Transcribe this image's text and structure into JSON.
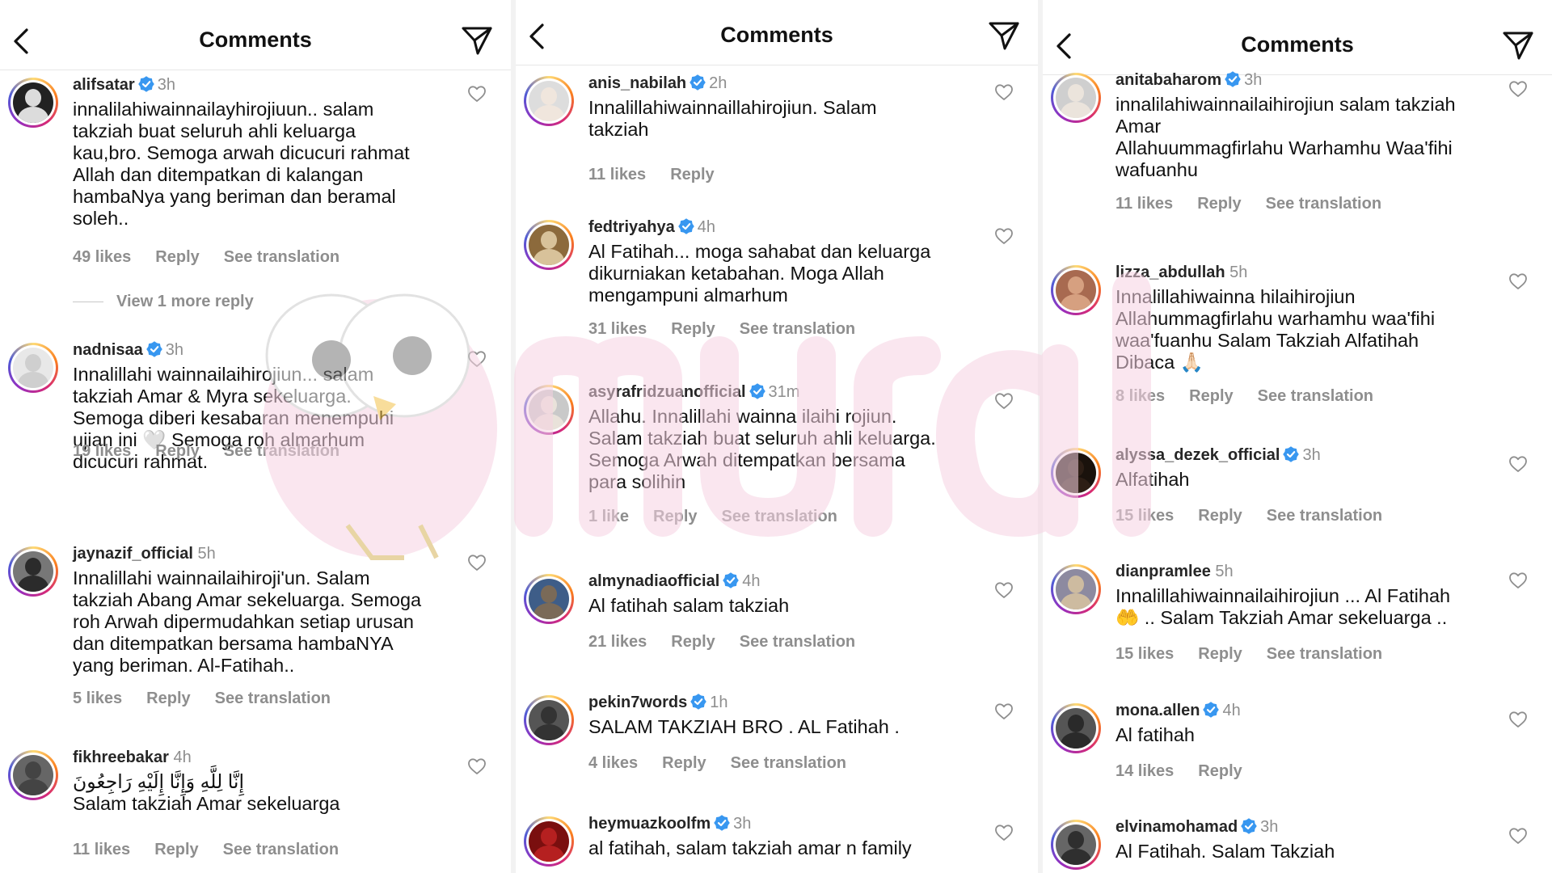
{
  "header_title": "Comments",
  "icons": {
    "back": "chevron-left-icon",
    "share": "send-icon",
    "verified": "verified-badge-icon",
    "like": "heart-outline-icon"
  },
  "colors": {
    "verified": "#3897f0",
    "secondary_text": "#8e8e8e",
    "watermark": "#f6d2e2"
  },
  "watermark": {
    "logo": "mural"
  },
  "panels": [
    {
      "comments": [
        {
          "username": "alifsatar",
          "verified": true,
          "time": "3h",
          "text": "innalilahiwainnailayhirojiuun.. salam\ntakziah buat seluruh ahli keluarga\nkau,bro. Semoga arwah dicucuri rahmat\nAllah dan ditempatkan di kalangan\nhambaNya yang beriman dan beramal\nsoleh..",
          "likes": "49 likes",
          "reply": "Reply",
          "translation": "See translation",
          "more_replies": "View 1 more reply"
        },
        {
          "username": "nadnisaa",
          "verified": true,
          "time": "3h",
          "text": "Innalillahi wainnailaihirojiun... salam\ntakziah Amar & Myra sekeluarga.\nSemoga diberi kesabaran menempuhi\nujian ini 🤍 Semoga roh almarhum\ndicucuri rahmat.",
          "likes": "19 likes",
          "reply": "Reply",
          "translation": "See translation"
        },
        {
          "username": "jaynazif_official",
          "verified": false,
          "time": "5h",
          "text": "Innalillahi wainnailaihiroji'un. Salam\ntakziah Abang Amar sekeluarga. Semoga\nroh Arwah dipermudahkan setiap urusan\ndan ditempatkan bersama hambaNYA\nyang beriman. Al-Fatihah..",
          "likes": "5 likes",
          "reply": "Reply",
          "translation": "See translation"
        },
        {
          "username": "fikhreebakar",
          "verified": false,
          "time": "4h",
          "text": "إِنَّا لِلَّهِ وَإِنَّا إِلَيْهِ رَاجِعُونَ\nSalam takziah Amar sekeluarga",
          "likes": "11 likes",
          "reply": "Reply",
          "translation": "See translation"
        }
      ]
    },
    {
      "comments": [
        {
          "username": "anis_nabilah",
          "verified": true,
          "time": "2h",
          "text": "Innalillahiwainnaillahirojiun. Salam\ntakziah",
          "likes": "11 likes",
          "reply": "Reply"
        },
        {
          "username": "fedtriyahya",
          "verified": true,
          "time": "4h",
          "text": "Al Fatihah... moga sahabat dan keluarga\ndikurniakan ketabahan. Moga Allah\nmengampuni almarhum",
          "likes": "31 likes",
          "reply": "Reply",
          "translation": "See translation"
        },
        {
          "username": "asyrafridzuanofficial",
          "verified": true,
          "time": "31m",
          "text": "Allahu. Innalillahi wainna ilaihi rojiun.\nSalam takziah buat seluruh ahli keluarga.\nSemoga Arwah ditempatkan bersama\npara solihin",
          "likes": "1 like",
          "reply": "Reply",
          "translation": "See translation"
        },
        {
          "username": "almynadiaofficial",
          "verified": true,
          "time": "4h",
          "text": "Al fatihah salam takziah",
          "likes": "21 likes",
          "reply": "Reply",
          "translation": "See translation"
        },
        {
          "username": "pekin7words",
          "verified": true,
          "time": "1h",
          "text": "SALAM TAKZIAH BRO . AL Fatihah .",
          "likes": "4 likes",
          "reply": "Reply",
          "translation": "See translation"
        },
        {
          "username": "heymuazkoolfm",
          "verified": true,
          "time": "3h",
          "text": "al fatihah, salam takziah amar n family"
        }
      ]
    },
    {
      "comments": [
        {
          "username": "anitabaharom",
          "verified": true,
          "time": "3h",
          "text": "innalilahiwainnailaihirojiun salam takziah\nAmar\nAllahuummagfirlahu Warhamhu Waa'fihi\nwafuanhu",
          "likes": "11 likes",
          "reply": "Reply",
          "translation": "See translation"
        },
        {
          "username": "lizza_abdullah",
          "verified": false,
          "time": "5h",
          "text": "Innalillahiwainna hilaihirojiun\nAllahummagfirlahu warhamhu waa'fihi\nwaa'fuanhu Salam Takziah Alfatihah\nDibaca 🙏🏻",
          "likes": "8 likes",
          "reply": "Reply",
          "translation": "See translation"
        },
        {
          "username": "alyssa_dezek_official",
          "verified": true,
          "time": "3h",
          "text": "Alfatihah",
          "likes": "15 likes",
          "reply": "Reply",
          "translation": "See translation"
        },
        {
          "username": "dianpramlee",
          "verified": false,
          "time": "5h",
          "text": "Innalillahiwainnailaihirojiun ... Al Fatihah\n🤲 .. Salam Takziah Amar sekeluarga ..",
          "likes": "15 likes",
          "reply": "Reply",
          "translation": "See translation"
        },
        {
          "username": "mona.allen",
          "verified": true,
          "time": "4h",
          "text": "Al fatihah",
          "likes": "14 likes",
          "reply": "Reply"
        },
        {
          "username": "elvinamohamad",
          "verified": true,
          "time": "3h",
          "text": "Al Fatihah. Salam Takziah"
        }
      ]
    }
  ]
}
